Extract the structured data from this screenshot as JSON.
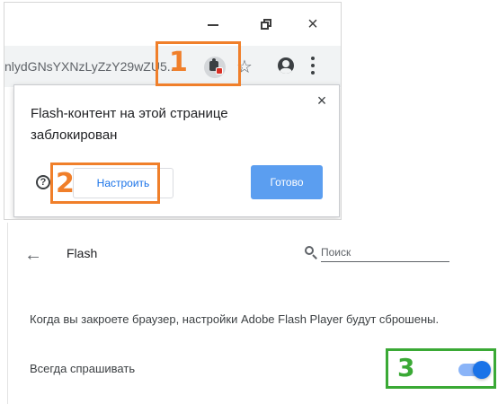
{
  "browser": {
    "url": "nlydGNsYXNzLyZzY29wZU5...",
    "icons": {
      "minimize": "minimize-icon",
      "restore": "restore-icon",
      "close": "×",
      "star": "☆",
      "menu": "more-vert-icon"
    }
  },
  "popup": {
    "message": "Flash-контент на этой странице заблокирован",
    "close_glyph": "×",
    "help_glyph": "?",
    "configure_label": "Настроить",
    "done_label": "Готово"
  },
  "markers": {
    "one": "1",
    "two": "2",
    "three": "3"
  },
  "settings": {
    "back_glyph": "←",
    "title": "Flash",
    "search_placeholder": "Поиск",
    "info": "Когда вы закроете браузер, настройки Adobe Flash Player будут сброшены.",
    "ask_label": "Всегда спрашивать",
    "ask_enabled": true
  },
  "colors": {
    "marker_orange": "#f07f2a",
    "marker_green": "#3aa935",
    "accent_blue": "#1a73e8",
    "done_button": "#5b9ef0",
    "blocked_red": "#d93025"
  }
}
